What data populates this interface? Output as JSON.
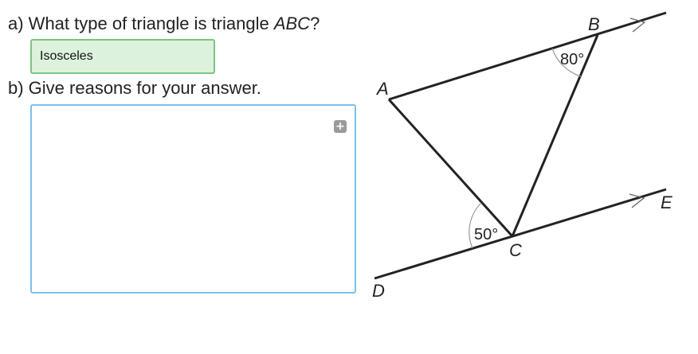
{
  "question_a": {
    "prefix": "a) What type of triangle is triangle ",
    "name": "ABC",
    "suffix": "?"
  },
  "answer_a": {
    "value": "Isosceles"
  },
  "question_b": {
    "text": "b) Give reasons for your answer."
  },
  "answer_b": {
    "value": "",
    "expand_icon": "plus-square-icon"
  },
  "diagram": {
    "points": {
      "A": "A",
      "B": "B",
      "C": "C",
      "D": "D",
      "E": "E"
    },
    "angle_B": "80°",
    "angle_C": "50°"
  }
}
